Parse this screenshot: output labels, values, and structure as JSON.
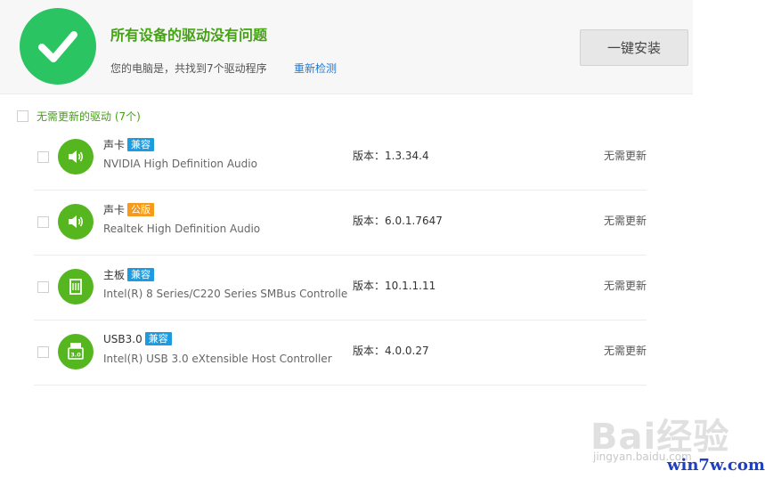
{
  "header": {
    "status_title": "所有设备的驱动没有问题",
    "status_sub": "您的电脑是，共找到7个驱动程序",
    "rescan_link": "重新检测",
    "install_button": "一键安装"
  },
  "group": {
    "label": "无需更新的驱动 (7个)"
  },
  "drivers": [
    {
      "type": "声卡",
      "badge": "兼容",
      "name": "NVIDIA High Definition Audio",
      "version": "版本：1.3.34.4",
      "status": "无需更新",
      "icon": "speaker-icon"
    },
    {
      "type": "声卡",
      "badge": "公版",
      "name": "Realtek High Definition Audio",
      "version": "版本：6.0.1.7647",
      "status": "无需更新",
      "icon": "speaker-icon"
    },
    {
      "type": "主板",
      "badge": "兼容",
      "name": "Intel(R) 8 Series/C220 Series SMBus Controlle",
      "version": "版本：10.1.1.11",
      "status": "无需更新",
      "icon": "motherboard-icon"
    },
    {
      "type": "USB3.0",
      "badge": "兼容",
      "name": "Intel(R) USB 3.0 eXtensible Host Controller",
      "version": "版本：4.0.0.27",
      "status": "无需更新",
      "icon": "usb3-icon"
    }
  ],
  "watermark": {
    "baidu": "Bai经验",
    "jingyan_url": "jingyan.baidu.com",
    "site": "win7w.com"
  },
  "colors": {
    "success_green": "#2bc462",
    "icon_green": "#55b61f",
    "title_green": "#43a312",
    "link_blue": "#1d7ad9",
    "badge_compat": "#1b9be0",
    "badge_public": "#f59a1b"
  }
}
